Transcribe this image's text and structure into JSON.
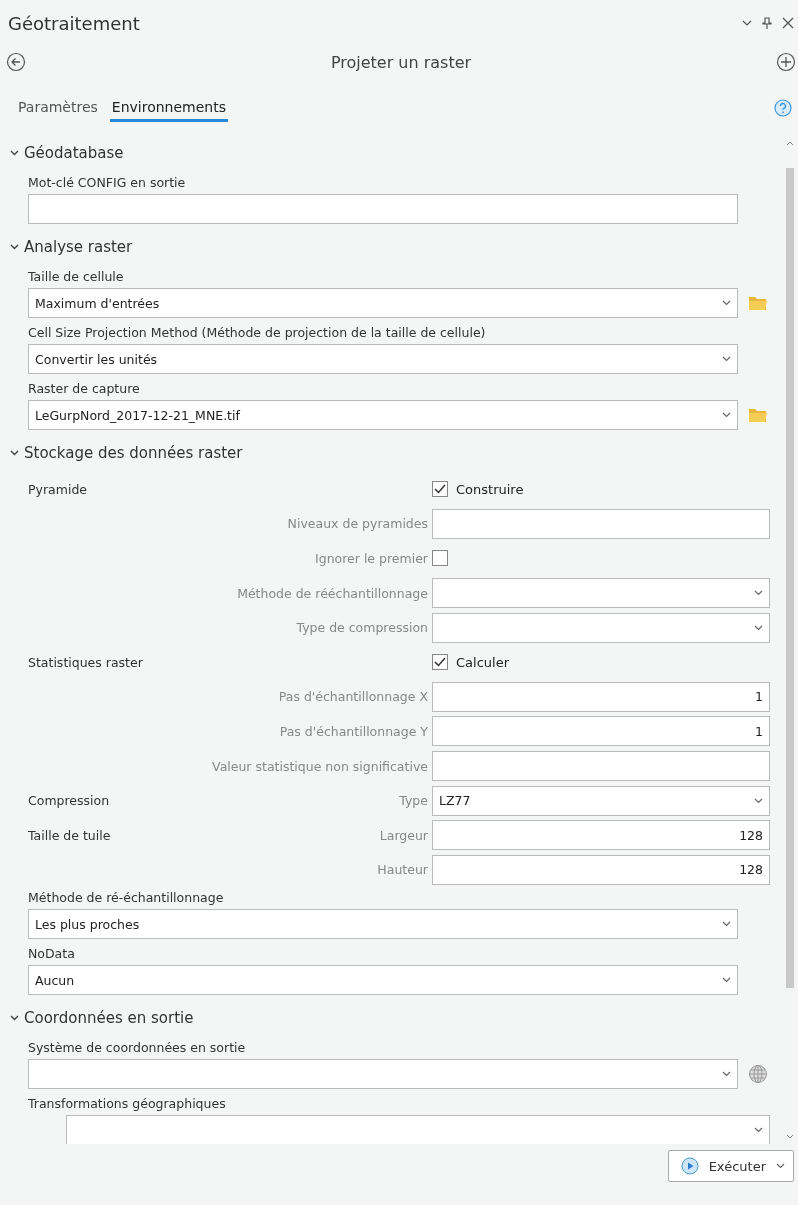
{
  "window": {
    "title": "Géotraitement"
  },
  "tool": {
    "title": "Projeter un raster"
  },
  "tabs": [
    {
      "label": "Paramètres",
      "selected": false
    },
    {
      "label": "Environnements",
      "selected": true
    }
  ],
  "sections": [
    {
      "title": "Géodatabase",
      "expanded": true,
      "rows": [
        {
          "kind": "stacked",
          "label": "Mot-clé CONFIG en sortie",
          "field": {
            "kind": "text"
          }
        }
      ]
    },
    {
      "title": "Analyse raster",
      "expanded": true,
      "rows": [
        {
          "kind": "stacked",
          "label": "Taille de cellule",
          "field": {
            "kind": "dropdown",
            "value": "Maximum d'entrées"
          },
          "button": {
            "kind": "folder"
          }
        },
        {
          "kind": "stacked",
          "label": "Cell Size Projection Method (Méthode de projection de la taille de cellule)",
          "field": {
            "kind": "dropdown",
            "value": "Convertir les unités"
          }
        },
        {
          "kind": "stacked",
          "label": "Raster de capture",
          "field": {
            "kind": "dropdown",
            "value": "LeGurpNord_2017-12-21_MNE.tif"
          },
          "button": {
            "kind": "folder"
          }
        }
      ]
    },
    {
      "title": "Stockage des données raster",
      "expanded": true,
      "rows": [
        {
          "kind": "check",
          "group": "Pyramide",
          "label": "Construire",
          "checked": true
        },
        {
          "kind": "inline",
          "label": "Niveaux de pyramides",
          "field": {
            "kind": "text"
          }
        },
        {
          "kind": "inline_check",
          "label": "Ignorer le premier",
          "checked": false
        },
        {
          "kind": "inline",
          "label": "Méthode de rééchantillonnage",
          "field": {
            "kind": "dropdown"
          }
        },
        {
          "kind": "inline",
          "label": "Type de compression",
          "field": {
            "kind": "dropdown"
          }
        },
        {
          "kind": "check",
          "group": "Statistiques raster",
          "label": "Calculer",
          "checked": true
        },
        {
          "kind": "inline",
          "label": "Pas d'échantillonnage X",
          "field": {
            "kind": "number",
            "value": "1"
          }
        },
        {
          "kind": "inline",
          "label": "Pas d'échantillonnage Y",
          "field": {
            "kind": "number",
            "value": "1"
          }
        },
        {
          "kind": "inline",
          "label": "Valeur statistique non significative",
          "field": {
            "kind": "text"
          }
        },
        {
          "kind": "inline",
          "group": "Compression",
          "label": "Type",
          "field": {
            "kind": "dropdown",
            "value": "LZ77"
          }
        },
        {
          "kind": "inline",
          "group": "Taille de tuile",
          "label": "Largeur",
          "field": {
            "kind": "number",
            "value": "128"
          }
        },
        {
          "kind": "inline",
          "label": "Hauteur",
          "field": {
            "kind": "number",
            "value": "128"
          }
        },
        {
          "kind": "stacked",
          "label": "Méthode de ré-échantillonnage",
          "field": {
            "kind": "dropdown",
            "value": "Les plus proches"
          }
        },
        {
          "kind": "stacked",
          "label": "NoData",
          "field": {
            "kind": "dropdown",
            "value": "Aucun"
          }
        }
      ]
    },
    {
      "title": "Coordonnées en sortie",
      "expanded": true,
      "rows": [
        {
          "kind": "stacked",
          "label": "Système de coordonnées en sortie",
          "field": {
            "kind": "dropdown"
          },
          "button": {
            "kind": "globe"
          }
        },
        {
          "kind": "indented",
          "label": "Transformations géographiques",
          "field": {
            "kind": "dropdown"
          }
        }
      ]
    }
  ],
  "run_button": {
    "label": "Exécuter"
  }
}
